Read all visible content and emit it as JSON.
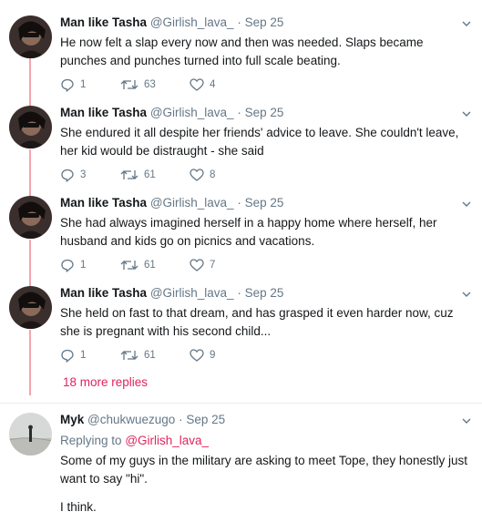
{
  "thread": {
    "tweets": [
      {
        "name": "Man like Tasha",
        "handle": "@Girlish_lava_",
        "date": "Sep 25",
        "text": "He now felt a slap every now and then was needed. Slaps became punches and punches turned into full scale beating.",
        "replies": "1",
        "retweets": "63",
        "likes": "4"
      },
      {
        "name": "Man like Tasha",
        "handle": "@Girlish_lava_",
        "date": "Sep 25",
        "text": "She endured it all despite her friends' advice to leave. She couldn't leave, her kid would be distraught - she said",
        "replies": "3",
        "retweets": "61",
        "likes": "8"
      },
      {
        "name": "Man like Tasha",
        "handle": "@Girlish_lava_",
        "date": "Sep 25",
        "text": "She had always imagined herself in a happy home where herself, her husband and kids go on picnics and vacations.",
        "replies": "1",
        "retweets": "61",
        "likes": "7"
      },
      {
        "name": "Man like Tasha",
        "handle": "@Girlish_lava_",
        "date": "Sep 25",
        "text": "She held on fast to that dream, and has grasped it even harder now, cuz she is pregnant with his second child...",
        "replies": "1",
        "retweets": "61",
        "likes": "9"
      }
    ],
    "more_replies": "18 more replies",
    "dot": "·"
  },
  "reply": {
    "name": "Myk",
    "handle": "@chukwuezugo",
    "date": "Sep 25",
    "replying_prefix": "Replying to",
    "replying_to": "@Girlish_lava_",
    "text_line1": "Some of my guys in the military are asking to meet Tope, they honestly just want to say \"hi\".",
    "text_line2": "I think."
  },
  "icons": {
    "reply": "reply-icon",
    "retweet": "retweet-icon",
    "like": "heart-icon",
    "more": "chevron-down-icon"
  },
  "colors": {
    "thread_line": "#f4a4ac",
    "link_red": "#e0245e",
    "muted": "#657786"
  }
}
